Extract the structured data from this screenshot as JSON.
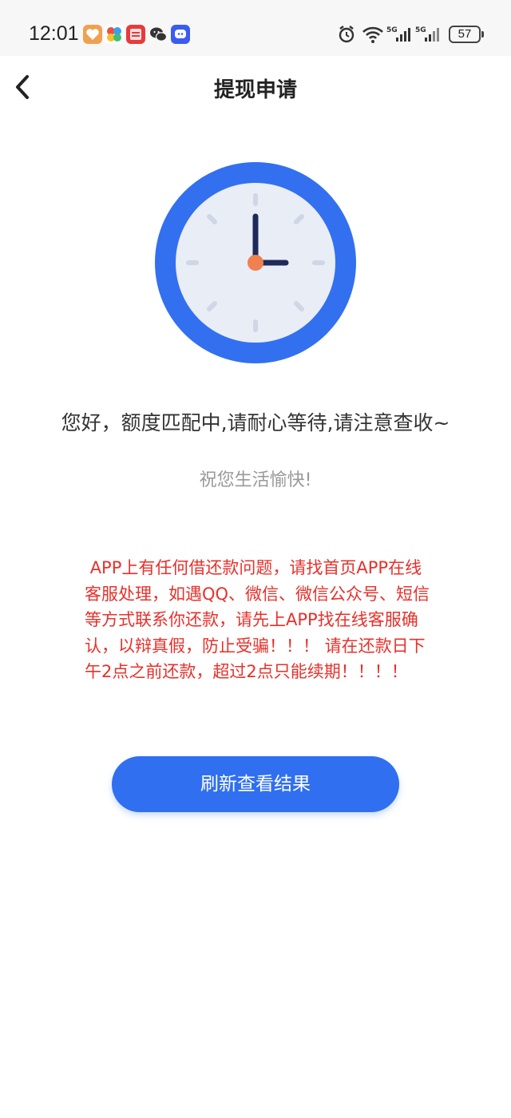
{
  "status_bar": {
    "time": "12:01",
    "battery": "57"
  },
  "header": {
    "title": "提现申请"
  },
  "main": {
    "message": "您好，额度匹配中,请耐心等待,请注意查收~",
    "sub_message": "祝您生活愉快!",
    "warning": " APP上有任何借还款问题，请找首页APP在线客服处理，如遇QQ、微信、微信公众号、短信等方式联系你还款，请先上APP找在线客服确认，以辩真假，防止受骗！！！ 请在还款日下午2点之前还款，超过2点只能续期！！！！",
    "refresh_button_label": "刷新查看结果"
  },
  "colors": {
    "accent": "#2f6ff0",
    "clock_ring": "#3370f0",
    "clock_face": "#e9edf5",
    "clock_hands": "#1e2a5a",
    "clock_center": "#f08050",
    "warning_text": "#e8302a"
  }
}
